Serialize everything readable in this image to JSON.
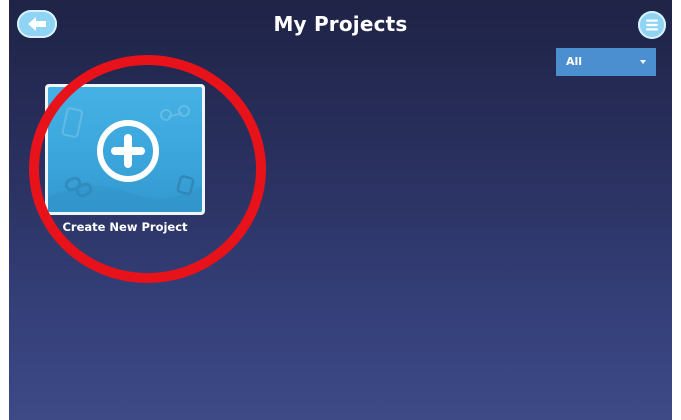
{
  "header": {
    "title": "My Projects",
    "back_icon": "arrow-left-icon",
    "menu_icon": "hamburger-menu-icon"
  },
  "filter": {
    "selected": "All",
    "caret_icon": "chevron-down-icon"
  },
  "projects": [
    {
      "label": "Create New Project",
      "icon": "plus-circle-icon"
    }
  ],
  "annotation": {
    "shape": "circle",
    "color": "#e8121b"
  },
  "colors": {
    "button_fill": "#8fd4f5",
    "dropdown_fill": "#4c8fd0",
    "card_fill": "#3ba6dc",
    "background_top": "#1f2346",
    "background_bottom": "#3d4a86"
  }
}
